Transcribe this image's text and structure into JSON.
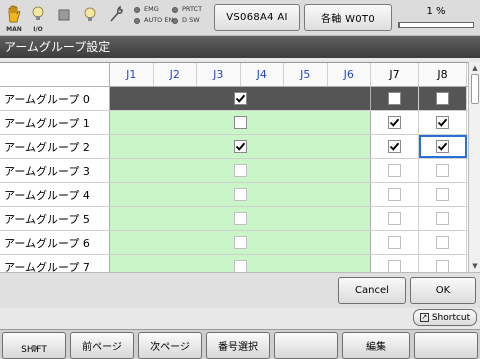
{
  "topbar": {
    "icons": [
      {
        "name": "hand-icon",
        "caption": "MAN"
      },
      {
        "name": "bulb-io-icon",
        "caption": "I/O"
      },
      {
        "name": "stop-square-icon",
        "caption": ""
      },
      {
        "name": "bulb-icon",
        "caption": ""
      },
      {
        "name": "wrench-icon",
        "caption": ""
      }
    ],
    "leds": [
      "EMG",
      "PRTCT",
      "AUTO EN",
      "D SW"
    ],
    "robot_button": "VS068A4 AI",
    "coord_button": "各軸 W0T0",
    "speed_label": "1 %",
    "speed_value": 0.01
  },
  "title": "アームグループ設定",
  "grid": {
    "columns": [
      "J1",
      "J2",
      "J3",
      "J4",
      "J5",
      "J6",
      "J7",
      "J8"
    ],
    "rows": [
      {
        "label": "アームグループ 0",
        "j1_6": true,
        "j7": false,
        "j8": false,
        "state": "selected"
      },
      {
        "label": "アームグループ 1",
        "j1_6": false,
        "j7": true,
        "j8": true,
        "state": "green"
      },
      {
        "label": "アームグループ 2",
        "j1_6": true,
        "j7": true,
        "j8": true,
        "state": "green",
        "focus": "j8"
      },
      {
        "label": "アームグループ 3",
        "j1_6": false,
        "j7": false,
        "j8": false,
        "state": "green"
      },
      {
        "label": "アームグループ 4",
        "j1_6": false,
        "j7": false,
        "j8": false,
        "state": "green"
      },
      {
        "label": "アームグループ 5",
        "j1_6": false,
        "j7": false,
        "j8": false,
        "state": "green"
      },
      {
        "label": "アームグループ 6",
        "j1_6": false,
        "j7": false,
        "j8": false,
        "state": "green"
      },
      {
        "label": "アームグループ 7",
        "j1_6": false,
        "j7": false,
        "j8": false,
        "state": "green"
      }
    ]
  },
  "dialog": {
    "cancel": "Cancel",
    "ok": "OK"
  },
  "shortcut": "Shortcut",
  "fkeys": [
    "SHIFT",
    "前ページ",
    "次ページ",
    "番号選択",
    "",
    "編集",
    ""
  ]
}
